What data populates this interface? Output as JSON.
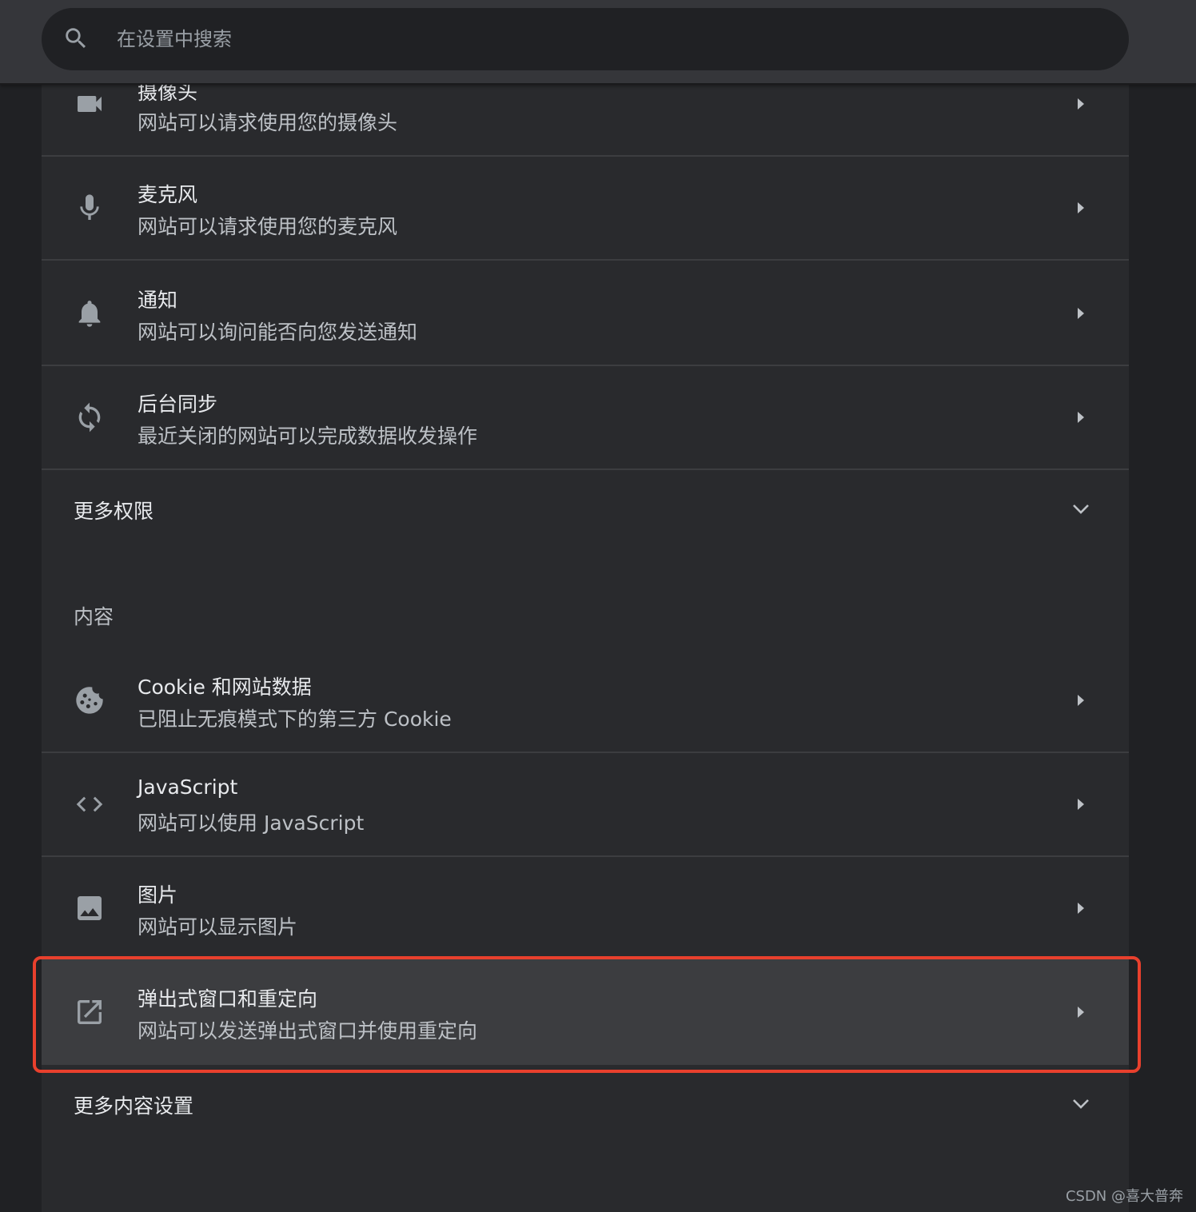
{
  "search": {
    "placeholder": "在设置中搜索",
    "icon": "search-icon"
  },
  "permissions": [
    {
      "title": "摄像头",
      "subtitle": "网站可以请求使用您的摄像头",
      "icon": "camera-icon"
    },
    {
      "title": "麦克风",
      "subtitle": "网站可以请求使用您的麦克风",
      "icon": "microphone-icon"
    },
    {
      "title": "通知",
      "subtitle": "网站可以询问能否向您发送通知",
      "icon": "bell-icon"
    },
    {
      "title": "后台同步",
      "subtitle": "最近关闭的网站可以完成数据收发操作",
      "icon": "sync-icon"
    }
  ],
  "more_permissions": {
    "label": "更多权限",
    "icon": "chevron-down-icon"
  },
  "content_header": "内容",
  "content": [
    {
      "title": "Cookie 和网站数据",
      "subtitle": "已阻止无痕模式下的第三方 Cookie",
      "icon": "cookie-icon"
    },
    {
      "title": "JavaScript",
      "subtitle": "网站可以使用 JavaScript",
      "icon": "code-icon"
    },
    {
      "title": "图片",
      "subtitle": "网站可以显示图片",
      "icon": "image-icon"
    },
    {
      "title": "弹出式窗口和重定向",
      "subtitle": "网站可以发送弹出式窗口并使用重定向",
      "icon": "open-in-new-icon",
      "highlighted": true
    }
  ],
  "more_content": {
    "label": "更多内容设置",
    "icon": "chevron-down-icon"
  },
  "watermark": "CSDN @喜大普奔",
  "colors": {
    "background": "#202124",
    "card": "#292a2d",
    "highlight_row": "#3c3d40",
    "highlight_frame": "#e8402d",
    "text_primary": "#e8eaed",
    "text_secondary": "#bdc1c6",
    "icon": "#9aa0a6"
  }
}
